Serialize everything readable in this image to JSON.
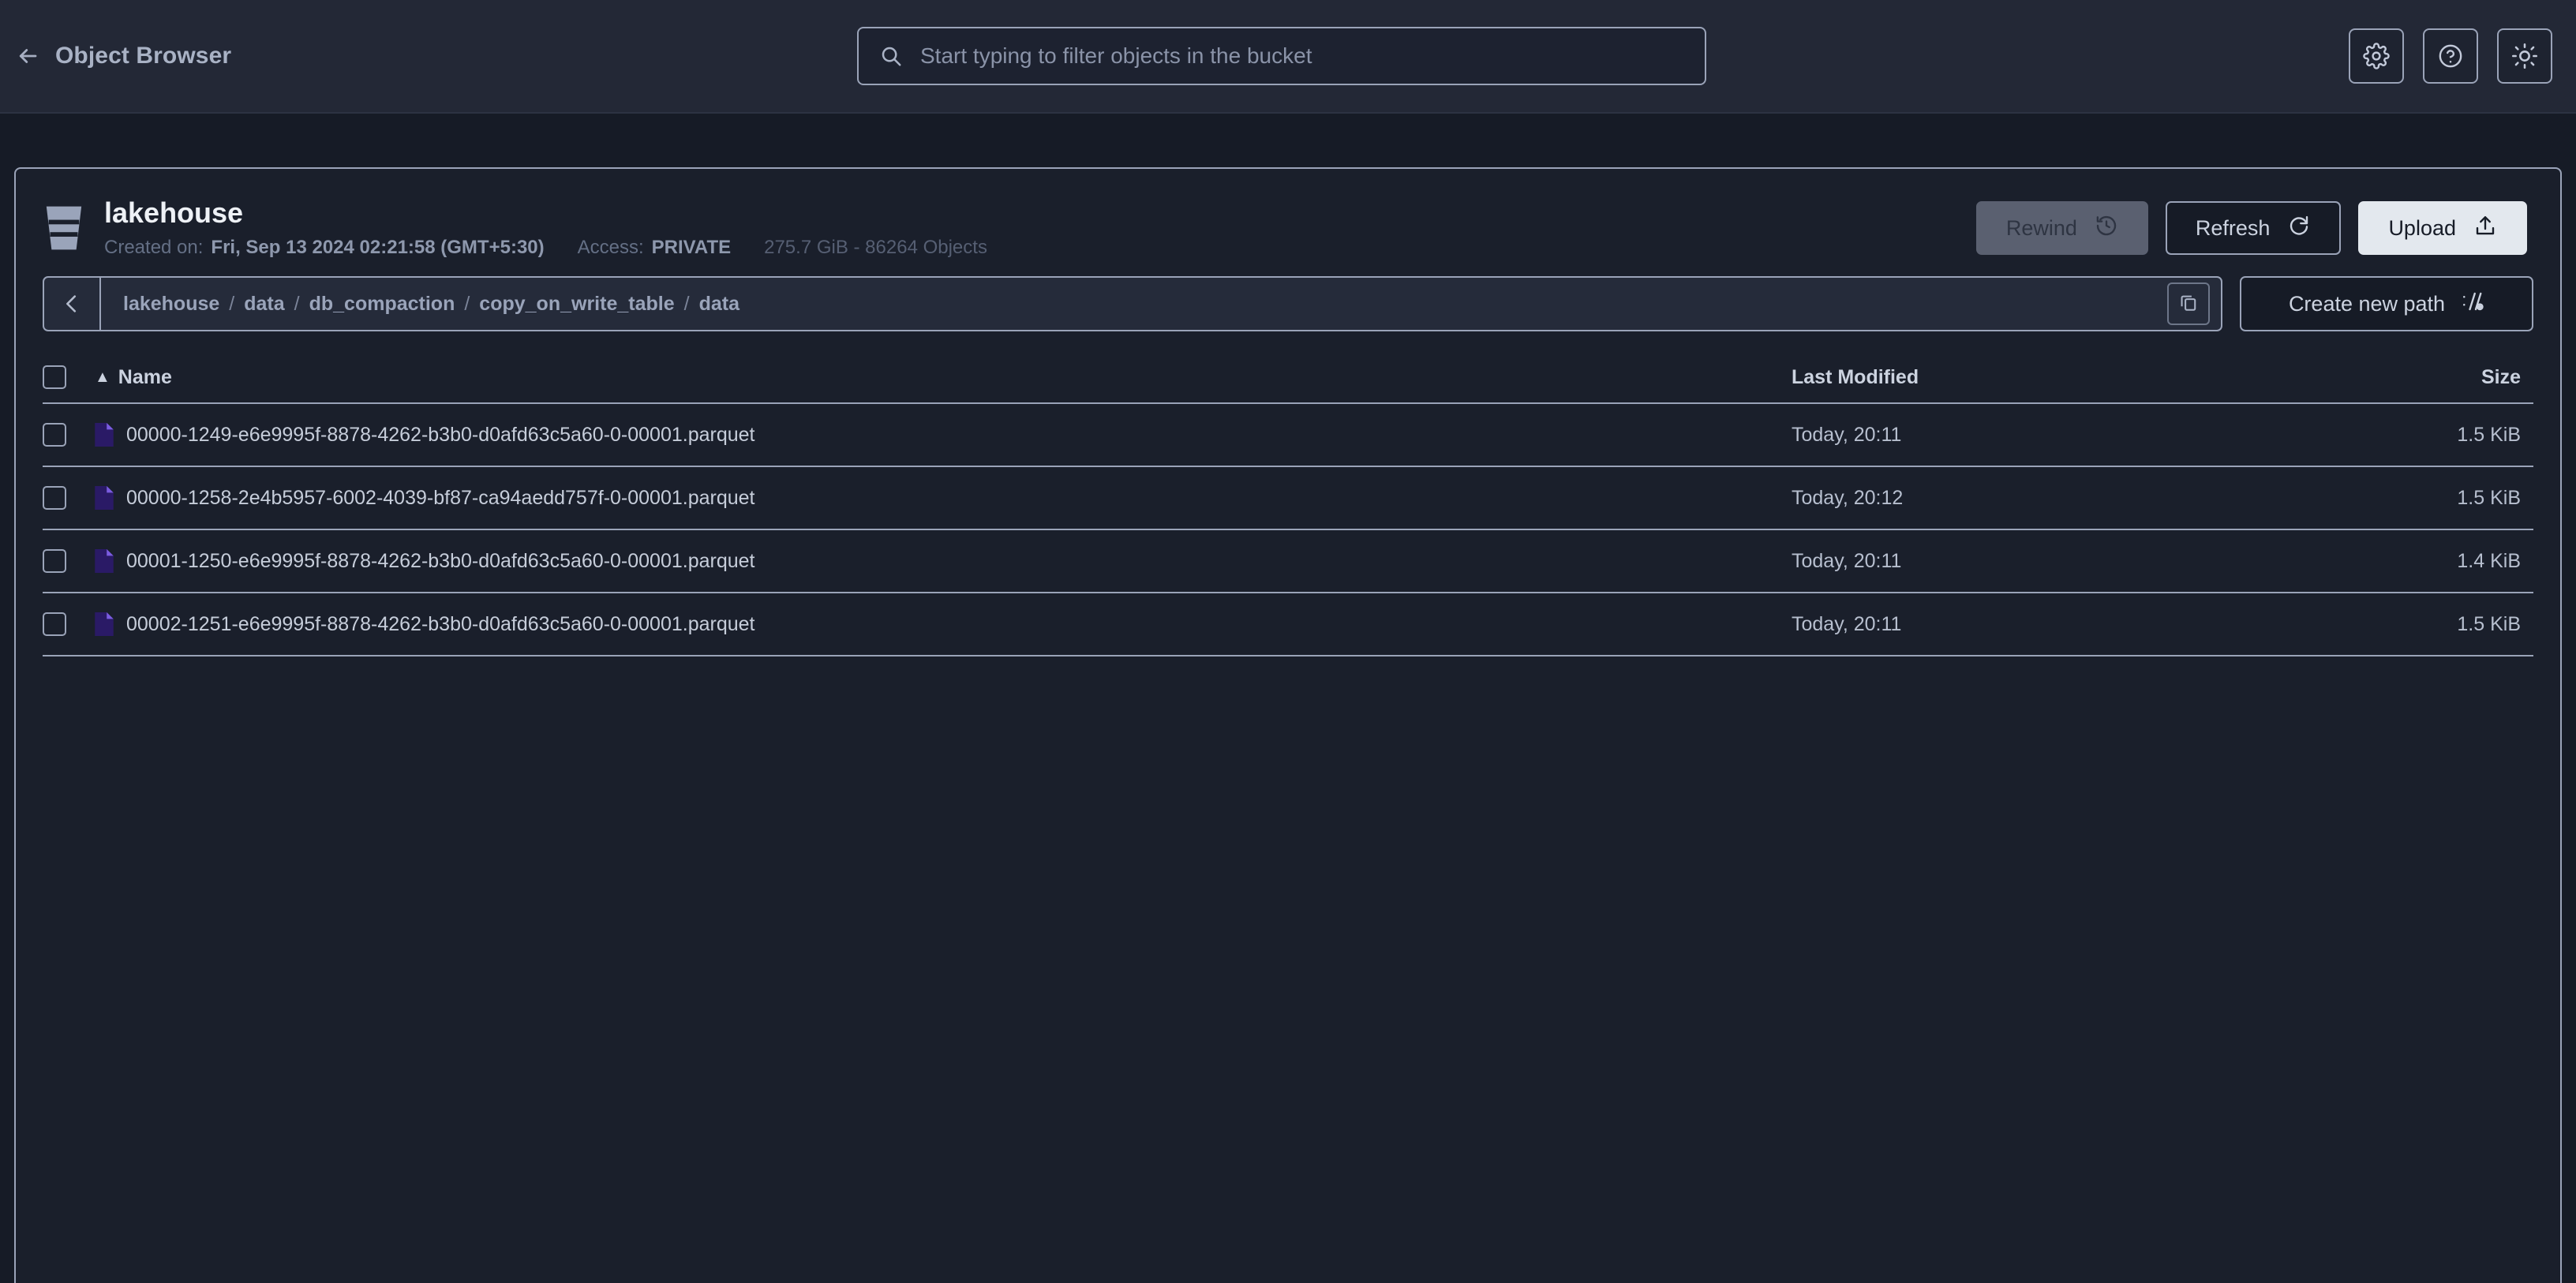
{
  "topbar": {
    "back_label": "Object Browser",
    "back_icon": "arrow-left-icon",
    "search": {
      "icon": "search-icon",
      "placeholder": "Start typing to filter objects in the bucket",
      "value": ""
    },
    "actions": [
      {
        "name": "settings-button",
        "icon": "gear-icon"
      },
      {
        "name": "help-button",
        "icon": "question-circle-icon"
      },
      {
        "name": "theme-toggle-button",
        "icon": "sun-icon"
      }
    ]
  },
  "bucket": {
    "icon": "bucket-icon",
    "name": "lakehouse",
    "created_label": "Created on:",
    "created_value": "Fri, Sep 13 2024 02:21:58 (GMT+5:30)",
    "access_label": "Access:",
    "access_value": "PRIVATE",
    "usage": "275.7 GiB - 86264 Objects"
  },
  "header_actions": {
    "rewind": {
      "label": "Rewind",
      "icon": "rewind-clock-icon",
      "disabled": true
    },
    "refresh": {
      "label": "Refresh",
      "icon": "refresh-icon",
      "disabled": false
    },
    "upload": {
      "label": "Upload",
      "icon": "upload-icon",
      "disabled": false
    }
  },
  "path": {
    "back_icon": "chevron-left-icon",
    "crumbs": [
      "lakehouse",
      "data",
      "db_compaction",
      "copy_on_write_table",
      "data"
    ],
    "separator": "/",
    "copy_icon": "copy-icon",
    "create_new_path": {
      "label": "Create new path",
      "icon": "new-path-icon"
    }
  },
  "table": {
    "columns": {
      "name": "Name",
      "last_modified": "Last Modified",
      "size": "Size"
    },
    "sort": {
      "column": "Name",
      "direction": "asc",
      "caret": "▲"
    },
    "rows": [
      {
        "name": "00000-1249-e6e9995f-8878-4262-b3b0-d0afd63c5a60-0-00001.parquet",
        "modified": "Today, 20:11",
        "size": "1.5 KiB",
        "icon": "parquet-file-icon"
      },
      {
        "name": "00000-1258-2e4b5957-6002-4039-bf87-ca94aedd757f-0-00001.parquet",
        "modified": "Today, 20:12",
        "size": "1.5 KiB",
        "icon": "parquet-file-icon"
      },
      {
        "name": "00001-1250-e6e9995f-8878-4262-b3b0-d0afd63c5a60-0-00001.parquet",
        "modified": "Today, 20:11",
        "size": "1.4 KiB",
        "icon": "parquet-file-icon"
      },
      {
        "name": "00002-1251-e6e9995f-8878-4262-b3b0-d0afd63c5a60-0-00001.parquet",
        "modified": "Today, 20:11",
        "size": "1.5 KiB",
        "icon": "parquet-file-icon"
      }
    ]
  },
  "colors": {
    "page_bg": "#161b26",
    "topbar_bg": "#232836",
    "panel_bg": "#1a1f2b",
    "border": "#9aa3b8",
    "text_primary": "#eef1f6",
    "text_muted": "#646f85",
    "file_icon": "#2a1a66",
    "upload_bg": "#e3e8ee"
  }
}
